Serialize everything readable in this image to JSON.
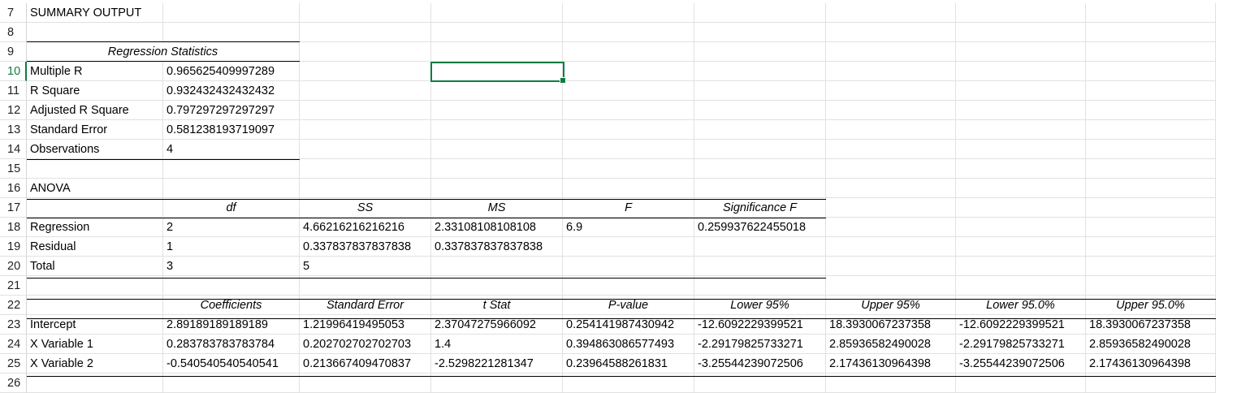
{
  "sheet": {
    "accent_color": "#107c41",
    "rows": [
      {
        "num": "7",
        "cells": [
          "SUMMARY OUTPUT",
          "",
          "",
          "",
          "",
          "",
          "",
          "",
          ""
        ]
      },
      {
        "num": "8",
        "cells": [
          "",
          "",
          "",
          "",
          "",
          "",
          "",
          "",
          ""
        ]
      },
      {
        "num": "9",
        "cells": [
          "",
          "",
          "",
          "",
          "",
          "",
          "",
          "",
          ""
        ],
        "merged_label": "Regression Statistics"
      },
      {
        "num": "10",
        "cells": [
          "Multiple R",
          "0.965625409997289",
          "",
          "",
          "",
          "",
          "",
          "",
          ""
        ]
      },
      {
        "num": "11",
        "cells": [
          "R Square",
          "0.932432432432432",
          "",
          "",
          "",
          "",
          "",
          "",
          ""
        ]
      },
      {
        "num": "12",
        "cells": [
          "Adjusted R Square",
          "0.797297297297297",
          "",
          "",
          "",
          "",
          "",
          "",
          ""
        ]
      },
      {
        "num": "13",
        "cells": [
          "Standard Error",
          "0.581238193719097",
          "",
          "",
          "",
          "",
          "",
          "",
          ""
        ]
      },
      {
        "num": "14",
        "cells": [
          "Observations",
          "4",
          "",
          "",
          "",
          "",
          "",
          "",
          ""
        ]
      },
      {
        "num": "15",
        "cells": [
          "",
          "",
          "",
          "",
          "",
          "",
          "",
          "",
          ""
        ]
      },
      {
        "num": "16",
        "cells": [
          "ANOVA",
          "",
          "",
          "",
          "",
          "",
          "",
          "",
          ""
        ]
      },
      {
        "num": "17",
        "cells": [
          "",
          "df",
          "SS",
          "MS",
          "F",
          "Significance F",
          "",
          "",
          ""
        ]
      },
      {
        "num": "18",
        "cells": [
          "Regression",
          "2",
          "4.66216216216216",
          "2.33108108108108",
          "6.9",
          "0.259937622455018",
          "",
          "",
          ""
        ]
      },
      {
        "num": "19",
        "cells": [
          "Residual",
          "1",
          "0.337837837837838",
          "0.337837837837838",
          "",
          "",
          "",
          "",
          ""
        ]
      },
      {
        "num": "20",
        "cells": [
          "Total",
          "3",
          "5",
          "",
          "",
          "",
          "",
          "",
          ""
        ]
      },
      {
        "num": "21",
        "cells": [
          "",
          "",
          "",
          "",
          "",
          "",
          "",
          "",
          ""
        ]
      },
      {
        "num": "22",
        "cells": [
          "",
          "Coefficients",
          "Standard Error",
          "t Stat",
          "P-value",
          "Lower 95%",
          "Upper 95%",
          "Lower 95.0%",
          "Upper 95.0%"
        ]
      },
      {
        "num": "23",
        "cells": [
          "Intercept",
          "2.89189189189189",
          "1.21996419495053",
          "2.37047275966092",
          "0.254141987430942",
          "-12.6092229399521",
          "18.3930067237358",
          "-12.6092229399521",
          "18.3930067237358"
        ]
      },
      {
        "num": "24",
        "cells": [
          "X Variable 1",
          "0.283783783783784",
          "0.202702702702703",
          "1.4",
          "0.394863086577493",
          "-2.29179825733271",
          "2.85936582490028",
          "-2.29179825733271",
          "2.85936582490028"
        ]
      },
      {
        "num": "25",
        "cells": [
          "X Variable 2",
          "-0.540540540540541",
          "0.213667409470837",
          "-2.5298221281347",
          "0.23964588261831",
          "-3.25544239072506",
          "2.17436130964398",
          "-3.25544239072506",
          "2.17436130964398"
        ]
      },
      {
        "num": "26",
        "cells": [
          "",
          "",
          "",
          "",
          "",
          "",
          "",
          "",
          ""
        ]
      }
    ]
  }
}
